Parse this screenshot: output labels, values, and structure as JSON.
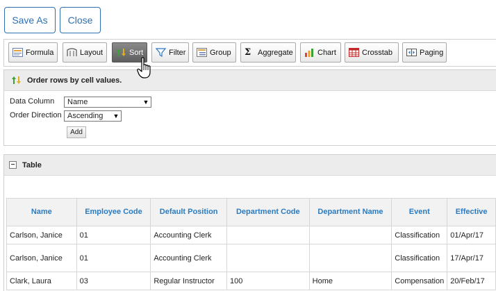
{
  "actions": {
    "save_as": "Save As",
    "close": "Close"
  },
  "toolbar": {
    "items": [
      {
        "label": "Formula",
        "icon": "formula-icon"
      },
      {
        "label": "Layout",
        "icon": "layout-icon"
      },
      {
        "label": "Sort",
        "icon": "sort-icon",
        "active": true
      },
      {
        "label": "Filter",
        "icon": "filter-icon"
      },
      {
        "label": "Group",
        "icon": "group-icon"
      },
      {
        "label": "Aggregate",
        "icon": "sigma-icon"
      },
      {
        "label": "Chart",
        "icon": "chart-icon"
      },
      {
        "label": "Crosstab",
        "icon": "crosstab-icon"
      },
      {
        "label": "Paging",
        "icon": "paging-icon"
      }
    ]
  },
  "sort_panel": {
    "title": "Order rows by cell values.",
    "data_column_label": "Data Column",
    "data_column_value": "Name",
    "order_direction_label": "Order Direction",
    "order_direction_value": "Ascending",
    "add_label": "Add"
  },
  "table_panel": {
    "title": "Table",
    "collapse_symbol": "−",
    "columns": [
      "Name",
      "Employee Code",
      "Default Position",
      "Department Code",
      "Department Name",
      "Event",
      "Effective"
    ],
    "rows": [
      [
        "Carlson, Janice",
        "01",
        "Accounting Clerk",
        "",
        "",
        "Classification",
        "01/Apr/17"
      ],
      [
        "Carlson, Janice",
        "01",
        "Accounting Clerk",
        "",
        "",
        "Classification",
        "17/Apr/17"
      ],
      [
        "Clark, Laura",
        "03",
        "Regular Instructor",
        "100",
        "Home",
        "Compensation",
        "20/Feb/17"
      ]
    ]
  },
  "colors": {
    "accent": "#2f6fb3",
    "header_text": "#2a7bc0",
    "active_button": "#6b6b6b"
  }
}
